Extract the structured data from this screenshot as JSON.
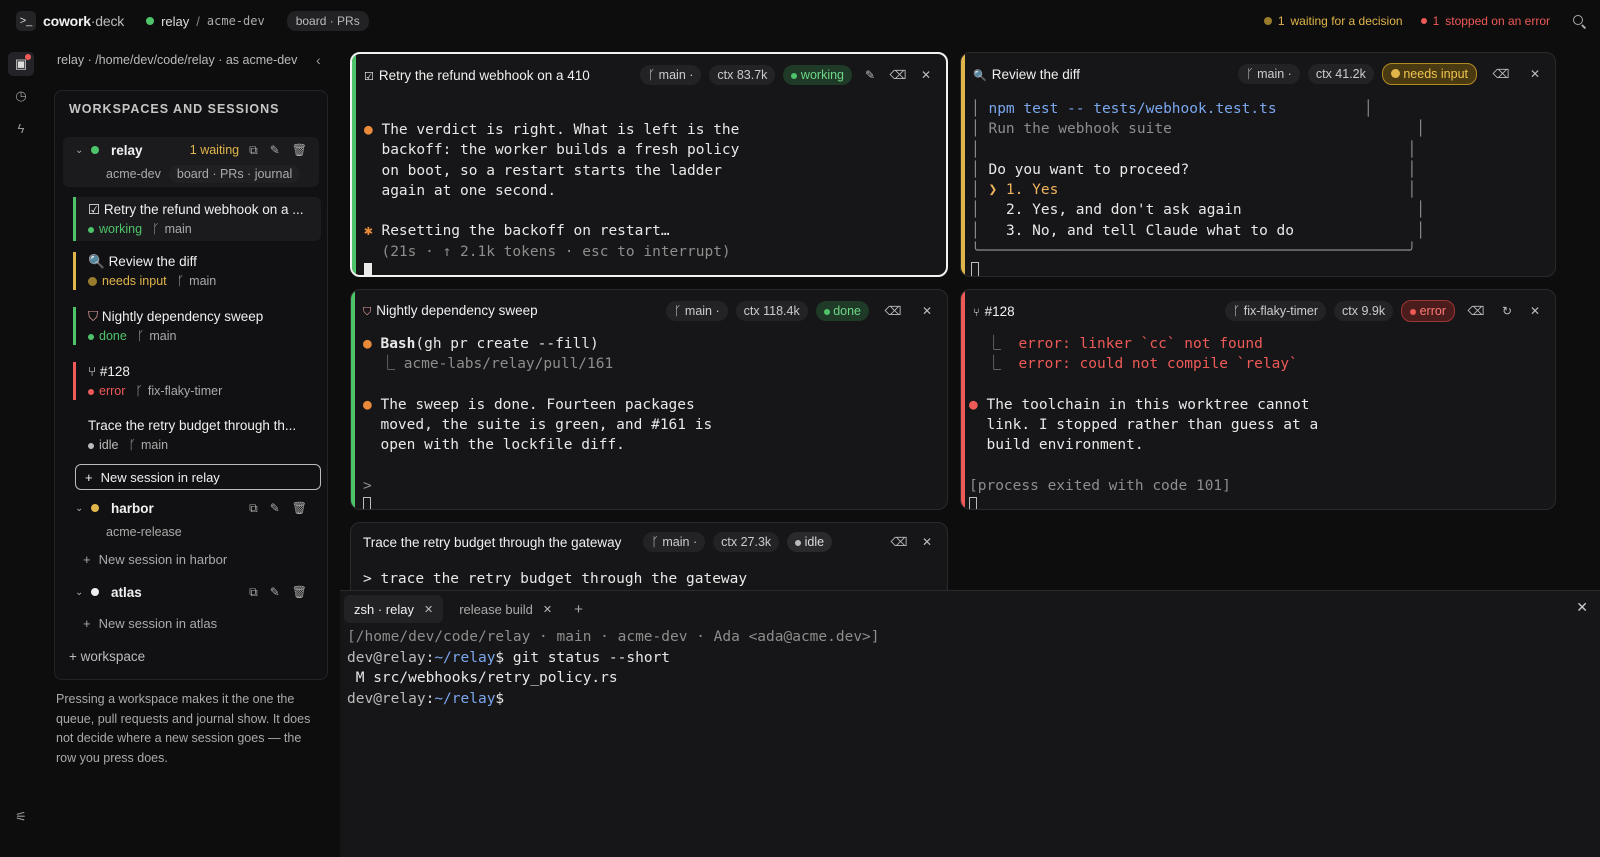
{
  "topbar": {
    "app_name_bold": "cowork",
    "app_name_thin": "·deck",
    "workspace": "relay",
    "separator": "/",
    "account": "acme-dev",
    "view_pill": "board · PRs",
    "waiting_count": "1",
    "waiting_label": "waiting for a decision",
    "error_count": "1",
    "error_label": "stopped on an error"
  },
  "sidebar": {
    "path": "relay · /home/dev/code/relay · as acme-dev",
    "panel_title": "WORKSPACES AND SESSIONS",
    "workspaces": [
      {
        "name": "relay",
        "waiting": "1 waiting",
        "account": "acme-dev",
        "tag": "board · PRs · journal"
      },
      {
        "name": "harbor",
        "account": "acme-release"
      },
      {
        "name": "atlas"
      }
    ],
    "sessions": [
      {
        "title": "Retry the refund webhook on a ...",
        "status": "working",
        "branch": "main"
      },
      {
        "title": "Review the diff",
        "status": "needs input",
        "branch": "main"
      },
      {
        "title": "Nightly dependency sweep",
        "status": "done",
        "branch": "main"
      },
      {
        "title": "#128",
        "status": "error",
        "branch": "fix-flaky-timer"
      },
      {
        "title": "Trace the retry budget through th...",
        "status": "idle",
        "branch": "main"
      }
    ],
    "new_session_relay": "New session in relay",
    "new_session_harbor": "New session in harbor",
    "new_session_atlas": "New session in atlas",
    "add_workspace": "+ workspace",
    "help_text": "Pressing a workspace makes it the one the queue, pull requests and journal show. It does not decide where a new session goes — the row you press does."
  },
  "panes": [
    {
      "title": "Retry the refund webhook on a 410",
      "branch": "main ·",
      "ctx": "ctx 83.7k",
      "status": "working",
      "lines": [
        "The verdict is right. What is left is the",
        "backoff: the worker builds a fresh policy",
        "on boot, so a restart starts the ladder",
        "again at one second.",
        "Resetting the backoff on restart…",
        "(21s · ↑ 2.1k tokens · esc to interrupt)"
      ]
    },
    {
      "title": "Review the diff",
      "branch": "main ·",
      "ctx": "ctx 41.2k",
      "status": "needs input",
      "lines": [
        "npm test -- tests/webhook.test.ts",
        "Run the webhook suite",
        "Do you want to proceed?",
        "❯ 1. Yes",
        "2. Yes, and don't ask again",
        "3. No, and tell Claude what to do"
      ]
    },
    {
      "title": "Nightly dependency sweep",
      "branch": "main ·",
      "ctx": "ctx 118.4k",
      "status": "done",
      "lines": [
        "Bash",
        "(gh pr create --fill)",
        "acme-labs/relay/pull/161",
        "The sweep is done. Fourteen packages",
        "moved, the suite is green, and #161 is",
        "open with the lockfile diff.",
        ">"
      ]
    },
    {
      "title": "#128",
      "branch": "fix-flaky-timer",
      "ctx": "ctx 9.9k",
      "status": "error",
      "lines": [
        "error: linker `cc` not found",
        "error: could not compile `relay`",
        "The toolchain in this worktree cannot",
        "link. I stopped rather than guess at a",
        "build environment.",
        "[process exited with code 101]"
      ]
    },
    {
      "title": "Trace the retry budget through the gateway",
      "branch": "main ·",
      "ctx": "ctx 27.3k",
      "status": "idle",
      "lines": [
        "> trace the retry budget through the gateway"
      ]
    }
  ],
  "terminal": {
    "tabs": [
      "zsh · relay",
      "release build"
    ],
    "context_line": "[/home/dev/code/relay · main · acme-dev · Ada <ada@acme.dev>]",
    "prompt_user": "dev@relay",
    "prompt_path": "~/relay",
    "command": "git status --short",
    "output": " M src/webhooks/retry_policy.rs"
  },
  "colors": {
    "working": "#4ec46a",
    "needs_input": "#e0b54a",
    "error": "#ee5a57",
    "done": "#4ec46a",
    "idle": "#bbbbbb"
  }
}
